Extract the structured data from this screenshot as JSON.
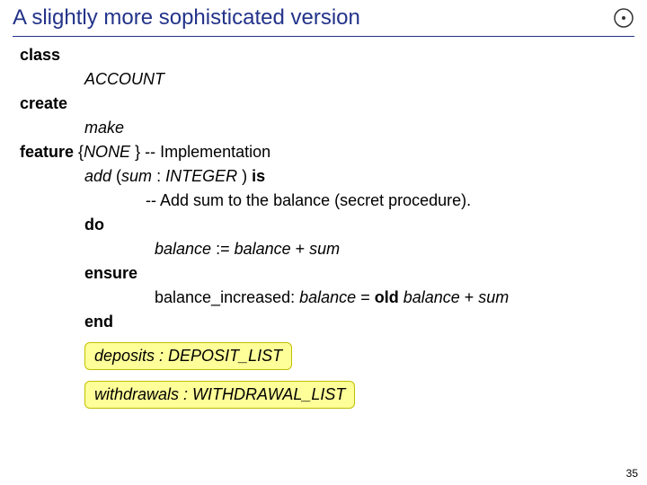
{
  "title": "A slightly more sophisticated version",
  "code": {
    "kw_class": "class",
    "classname": "ACCOUNT",
    "kw_create": "create",
    "create_proc": "make",
    "kw_feature": "feature",
    "feature_vis_open": "{",
    "feature_vis_none": "NONE ",
    "feature_vis_close": "} -- Implementation",
    "add_sig_1": "add",
    "add_sig_2": " (",
    "add_sig_3": "sum",
    "add_sig_4": " : ",
    "add_sig_5": "INTEGER",
    "add_sig_6": " ) ",
    "add_sig_7": "is",
    "comment": "-- Add sum to the balance (secret procedure).",
    "kw_do": "do",
    "body_1": "balance",
    "body_2": " := ",
    "body_3": "balance",
    "body_4": " + ",
    "body_5": "sum",
    "kw_ensure": "ensure",
    "post_tag": "balance_increased: ",
    "post_b1": "balance",
    "post_eq": " = ",
    "post_old": "old",
    "post_sp": " ",
    "post_b2": "balance",
    "post_plus": " + ",
    "post_s": "sum",
    "kw_end": "end",
    "deposits": "deposits : DEPOSIT_LIST",
    "withdrawals": "withdrawals : WITHDRAWAL_LIST"
  },
  "page_number": "35"
}
